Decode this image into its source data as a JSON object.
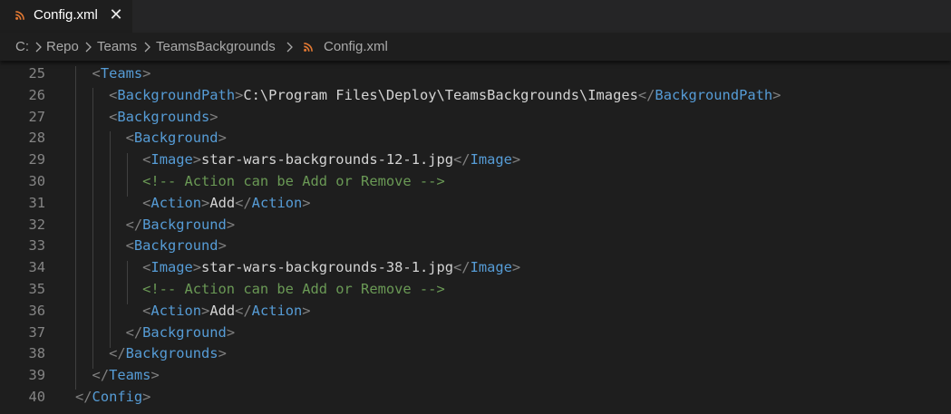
{
  "tab": {
    "icon": "rss-icon",
    "title": "Config.xml",
    "close_symbol": "✕"
  },
  "breadcrumb": {
    "items": [
      "C:",
      "Repo",
      "Teams",
      "TeamsBackgrounds",
      "Config.xml"
    ],
    "file_icon": "rss-icon"
  },
  "colors": {
    "tag": "#569cd6",
    "bracket": "#808080",
    "text": "#d4d4d4",
    "comment": "#6a9955",
    "line_number": "#858585",
    "file_icon": "#e37933"
  },
  "editor": {
    "lines": [
      {
        "number": "25",
        "indent": "  ",
        "parts": [
          {
            "t": "br",
            "v": "<"
          },
          {
            "t": "tag",
            "v": "Teams"
          },
          {
            "t": "br",
            "v": ">"
          }
        ]
      },
      {
        "number": "26",
        "indent": "    ",
        "parts": [
          {
            "t": "br",
            "v": "<"
          },
          {
            "t": "tag",
            "v": "BackgroundPath"
          },
          {
            "t": "br",
            "v": ">"
          },
          {
            "t": "txt",
            "v": "C:\\Program Files\\Deploy\\TeamsBackgrounds\\Images"
          },
          {
            "t": "br",
            "v": "</"
          },
          {
            "t": "tag",
            "v": "BackgroundPath"
          },
          {
            "t": "br",
            "v": ">"
          }
        ]
      },
      {
        "number": "27",
        "indent": "    ",
        "parts": [
          {
            "t": "br",
            "v": "<"
          },
          {
            "t": "tag",
            "v": "Backgrounds"
          },
          {
            "t": "br",
            "v": ">"
          }
        ]
      },
      {
        "number": "28",
        "indent": "      ",
        "parts": [
          {
            "t": "br",
            "v": "<"
          },
          {
            "t": "tag",
            "v": "Background"
          },
          {
            "t": "br",
            "v": ">"
          }
        ]
      },
      {
        "number": "29",
        "indent": "        ",
        "parts": [
          {
            "t": "br",
            "v": "<"
          },
          {
            "t": "tag",
            "v": "Image"
          },
          {
            "t": "br",
            "v": ">"
          },
          {
            "t": "txt",
            "v": "star-wars-backgrounds-12-1.jpg"
          },
          {
            "t": "br",
            "v": "</"
          },
          {
            "t": "tag",
            "v": "Image"
          },
          {
            "t": "br",
            "v": ">"
          }
        ]
      },
      {
        "number": "30",
        "indent": "        ",
        "parts": [
          {
            "t": "cmt",
            "v": "<!-- Action can be Add or Remove -->"
          }
        ]
      },
      {
        "number": "31",
        "indent": "        ",
        "parts": [
          {
            "t": "br",
            "v": "<"
          },
          {
            "t": "tag",
            "v": "Action"
          },
          {
            "t": "br",
            "v": ">"
          },
          {
            "t": "txt",
            "v": "Add"
          },
          {
            "t": "br",
            "v": "</"
          },
          {
            "t": "tag",
            "v": "Action"
          },
          {
            "t": "br",
            "v": ">"
          }
        ]
      },
      {
        "number": "32",
        "indent": "      ",
        "parts": [
          {
            "t": "br",
            "v": "</"
          },
          {
            "t": "tag",
            "v": "Background"
          },
          {
            "t": "br",
            "v": ">"
          }
        ]
      },
      {
        "number": "33",
        "indent": "      ",
        "parts": [
          {
            "t": "br",
            "v": "<"
          },
          {
            "t": "tag",
            "v": "Background"
          },
          {
            "t": "br",
            "v": ">"
          }
        ]
      },
      {
        "number": "34",
        "indent": "        ",
        "parts": [
          {
            "t": "br",
            "v": "<"
          },
          {
            "t": "tag",
            "v": "Image"
          },
          {
            "t": "br",
            "v": ">"
          },
          {
            "t": "txt",
            "v": "star-wars-backgrounds-38-1.jpg"
          },
          {
            "t": "br",
            "v": "</"
          },
          {
            "t": "tag",
            "v": "Image"
          },
          {
            "t": "br",
            "v": ">"
          }
        ]
      },
      {
        "number": "35",
        "indent": "        ",
        "parts": [
          {
            "t": "cmt",
            "v": "<!-- Action can be Add or Remove -->"
          }
        ]
      },
      {
        "number": "36",
        "indent": "        ",
        "parts": [
          {
            "t": "br",
            "v": "<"
          },
          {
            "t": "tag",
            "v": "Action"
          },
          {
            "t": "br",
            "v": ">"
          },
          {
            "t": "txt",
            "v": "Add"
          },
          {
            "t": "br",
            "v": "</"
          },
          {
            "t": "tag",
            "v": "Action"
          },
          {
            "t": "br",
            "v": ">"
          }
        ]
      },
      {
        "number": "37",
        "indent": "      ",
        "parts": [
          {
            "t": "br",
            "v": "</"
          },
          {
            "t": "tag",
            "v": "Background"
          },
          {
            "t": "br",
            "v": ">"
          }
        ]
      },
      {
        "number": "38",
        "indent": "    ",
        "parts": [
          {
            "t": "br",
            "v": "</"
          },
          {
            "t": "tag",
            "v": "Backgrounds"
          },
          {
            "t": "br",
            "v": ">"
          }
        ]
      },
      {
        "number": "39",
        "indent": "  ",
        "parts": [
          {
            "t": "br",
            "v": "</"
          },
          {
            "t": "tag",
            "v": "Teams"
          },
          {
            "t": "br",
            "v": ">"
          }
        ]
      },
      {
        "number": "40",
        "indent": "",
        "parts": [
          {
            "t": "br",
            "v": "</"
          },
          {
            "t": "tag",
            "v": "Config"
          },
          {
            "t": "br",
            "v": ">"
          }
        ]
      }
    ]
  }
}
